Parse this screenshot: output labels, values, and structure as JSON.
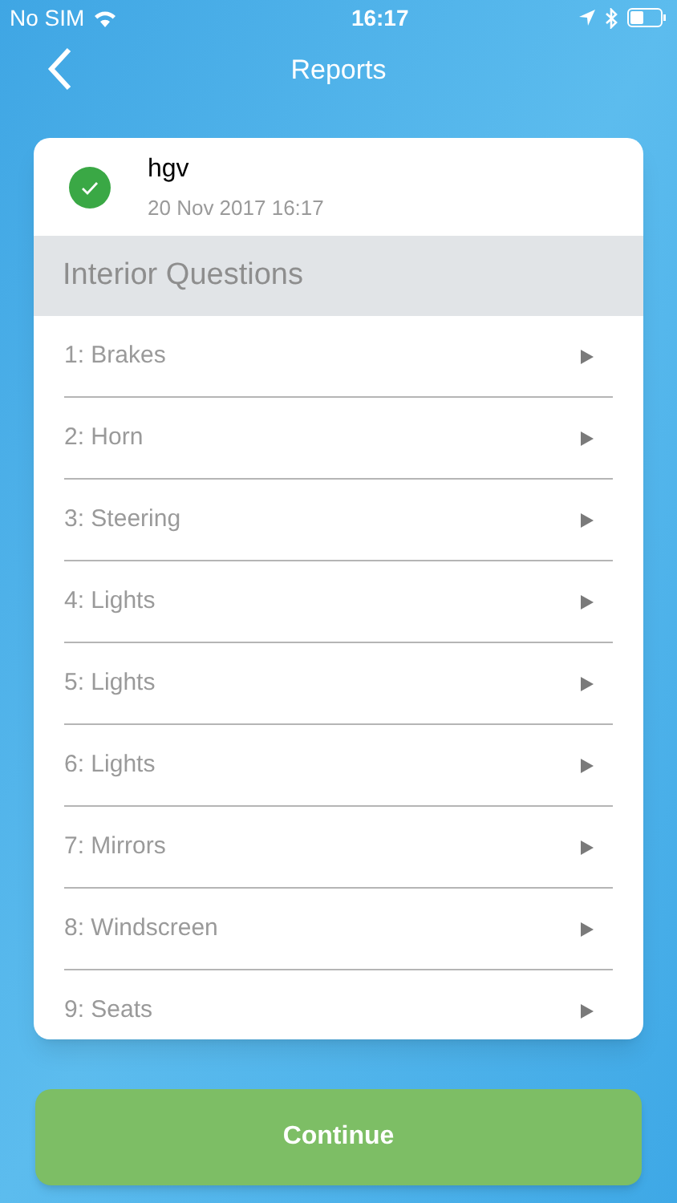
{
  "status_bar": {
    "carrier": "No SIM",
    "time": "16:17"
  },
  "nav": {
    "title": "Reports"
  },
  "report": {
    "name": "hgv",
    "date": "20 Nov 2017 16:17"
  },
  "section": {
    "title": "Interior Questions"
  },
  "questions": [
    {
      "label": "1: Brakes"
    },
    {
      "label": "2: Horn"
    },
    {
      "label": "3: Steering"
    },
    {
      "label": "4: Lights"
    },
    {
      "label": "5: Lights"
    },
    {
      "label": "6: Lights"
    },
    {
      "label": "7: Mirrors"
    },
    {
      "label": "8: Windscreen"
    },
    {
      "label": "9: Seats"
    }
  ],
  "continue_button": {
    "label": "Continue"
  }
}
